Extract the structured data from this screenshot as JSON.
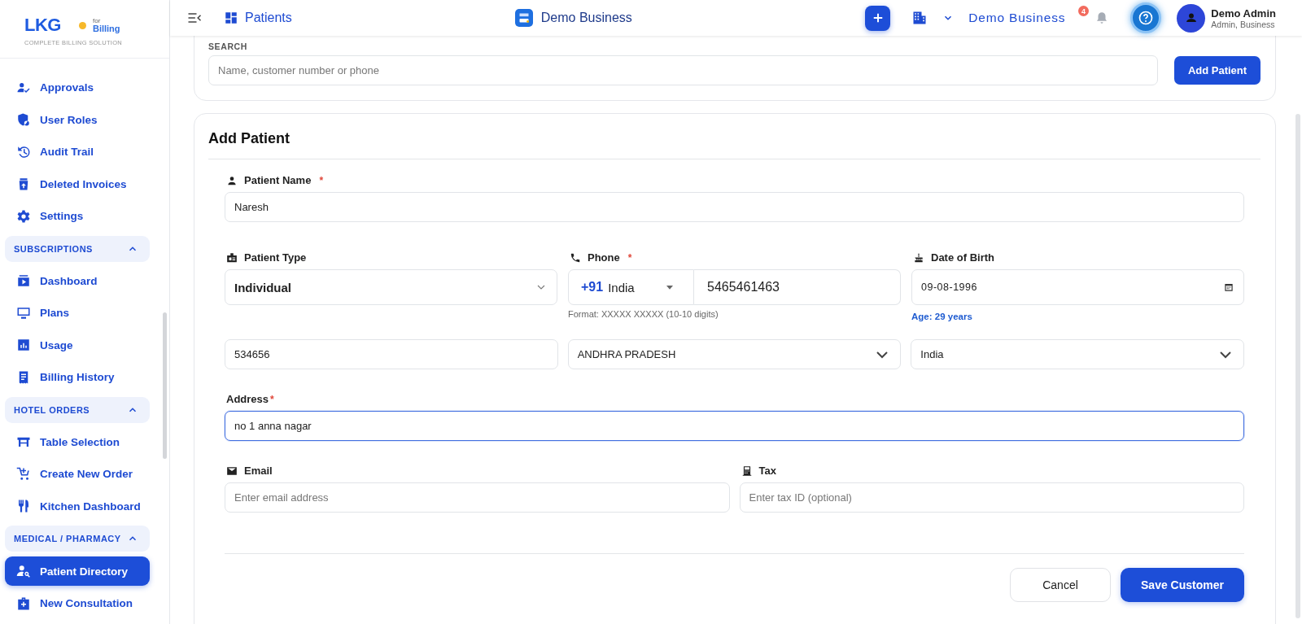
{
  "sidebar": {
    "logo": {
      "mark": "LKG",
      "for": "for",
      "product": "Billing",
      "tagline": "COMPLETE BILLING SOLUTION"
    },
    "groups": [
      {
        "items": [
          {
            "label": "Approvals",
            "selected": false
          },
          {
            "label": "User Roles",
            "selected": false
          },
          {
            "label": "Audit Trail",
            "selected": false
          },
          {
            "label": "Deleted Invoices",
            "selected": false
          },
          {
            "label": "Settings",
            "selected": false
          }
        ]
      },
      {
        "title": "SUBSCRIPTIONS",
        "expanded": true,
        "items": [
          {
            "label": "Dashboard",
            "selected": false
          },
          {
            "label": "Plans",
            "selected": false
          },
          {
            "label": "Usage",
            "selected": false
          },
          {
            "label": "Billing History",
            "selected": false
          }
        ]
      },
      {
        "title": "HOTEL ORDERS",
        "expanded": true,
        "items": [
          {
            "label": "Table Selection",
            "selected": false
          },
          {
            "label": "Create New Order",
            "selected": false
          },
          {
            "label": "Kitchen Dashboard",
            "selected": false
          }
        ]
      },
      {
        "title": "MEDICAL / PHARMACY",
        "expanded": true,
        "items": [
          {
            "label": "Patient Directory",
            "selected": true
          },
          {
            "label": "New Consultation",
            "selected": false
          }
        ]
      }
    ]
  },
  "header": {
    "page_title": "Patients",
    "app_title": "Demo Business",
    "business": "Demo Business",
    "notifications": "4",
    "user": {
      "name": "Demo Admin",
      "role": "Admin, Business"
    }
  },
  "search": {
    "label": "SEARCH",
    "placeholder": "Name, customer number or phone",
    "button": "Add Patient"
  },
  "add_patient": {
    "title": "Add Patient",
    "patient_name": {
      "label": "Patient Name",
      "required_mark": "*",
      "value": "Naresh"
    },
    "patient_type": {
      "label": "Patient Type",
      "value": "Individual"
    },
    "phone": {
      "label": "Phone",
      "required_mark": "*",
      "code": "+91",
      "country": "India",
      "value": "5465461463",
      "hint": "Format: XXXXX XXXXX (10-10 digits)"
    },
    "date_of_birth": {
      "label": "Date of Birth",
      "value": "09-08-1996",
      "age": "Age: 29 years"
    },
    "postal_code": {
      "value": "534656"
    },
    "state": {
      "value": "ANDHRA PRADESH"
    },
    "country": {
      "value": "India"
    },
    "address": {
      "label": "Address",
      "required_mark": "*",
      "value": "no 1 anna nagar",
      "focused": true
    },
    "email": {
      "label": "Email",
      "placeholder": "Enter email address"
    },
    "tax": {
      "label": "Tax",
      "placeholder": "Enter tax ID (optional)"
    },
    "cancel": "Cancel",
    "save": "Save Customer"
  }
}
